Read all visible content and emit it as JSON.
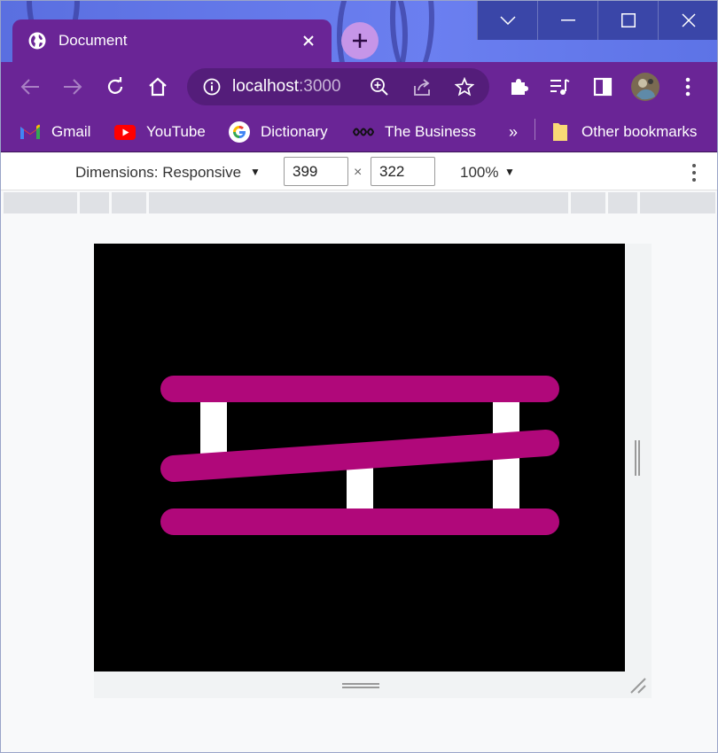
{
  "window": {
    "controls": [
      "chevron-down",
      "minimize",
      "maximize",
      "close"
    ]
  },
  "tab": {
    "title": "Document",
    "favicon": "globe-icon"
  },
  "toolbar": {
    "url_host": "localhost",
    "url_port": ":3000"
  },
  "bookmarks": {
    "items": [
      {
        "label": "Gmail",
        "icon": "gmail-icon"
      },
      {
        "label": "YouTube",
        "icon": "youtube-icon"
      },
      {
        "label": "Dictionary",
        "icon": "google-icon"
      },
      {
        "label": "The Business",
        "icon": "abc-icon"
      }
    ],
    "overflow": "»",
    "other": "Other bookmarks"
  },
  "device_toolbar": {
    "dimensions_label": "Dimensions: Responsive",
    "width": "399",
    "height": "322",
    "times": "×",
    "zoom": "100%"
  },
  "colors": {
    "chrome_purple": "#6a2596",
    "bar_magenta": "#b0087a",
    "post_white": "#ffffff",
    "canvas_black": "#000000"
  }
}
